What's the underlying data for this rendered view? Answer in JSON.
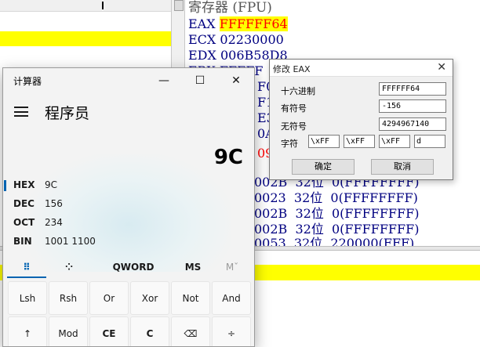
{
  "debugger": {
    "reg_title": "寄存器 (FPU)",
    "registers": [
      {
        "name": "EAX",
        "value": "FFFFFF64",
        "highlight": true
      },
      {
        "name": "ECX",
        "value": "02230000"
      },
      {
        "name": "EDX",
        "value": "006B58D8"
      },
      {
        "name": "EBX",
        "value": "FFFFF"
      }
    ],
    "partial_rows": [
      "F05",
      "F1",
      "E38",
      "0A",
      "094"
    ],
    "segments": [
      {
        "text": "002B  32位  0(FFFFFFFF)"
      },
      {
        "text": "0023  32位  0(FFFFFFFF)"
      },
      {
        "text": "002B  32位  0(FFFFFFFF)"
      },
      {
        "text": "002B  32位  0(FFFFFFFF)"
      },
      {
        "text": "0053  32位  220000(FFF)"
      }
    ]
  },
  "calculator": {
    "app_title": "计算器",
    "window_buttons": {
      "minimize": "—",
      "maximize": "☐",
      "close": "✕"
    },
    "mode_title": "程序员",
    "display_value": "9C",
    "radix": [
      {
        "name": "HEX",
        "value": "9C",
        "selected": true
      },
      {
        "name": "DEC",
        "value": "156"
      },
      {
        "name": "OCT",
        "value": "234"
      },
      {
        "name": "BIN",
        "value": "1001 1100"
      }
    ],
    "tabs": {
      "keypad": "⠿",
      "bit": "⁘",
      "word": "QWORD",
      "ms": "MS",
      "m": "Mˇ"
    },
    "keys_row1": [
      "Lsh",
      "Rsh",
      "Or",
      "Xor",
      "Not",
      "And"
    ],
    "keys_row2": [
      "↑",
      "Mod",
      "CE",
      "C",
      "⌫",
      "÷"
    ]
  },
  "dialog": {
    "title": "修改 EAX",
    "close": "✕",
    "hex_label": "十六进制",
    "hex_value": "FFFFFF64",
    "signed_label": "有符号",
    "signed_value": "-156",
    "unsigned_label": "无符号",
    "unsigned_value": "4294967140",
    "char_label": "字符",
    "char_values": [
      "\\xFF",
      "\\xFF",
      "\\xFF",
      "d"
    ],
    "ok": "确定",
    "cancel": "取消"
  }
}
